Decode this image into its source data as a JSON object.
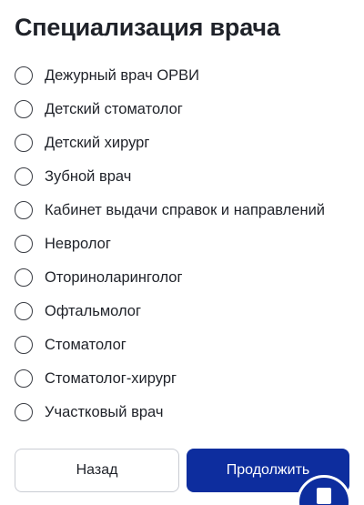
{
  "header": {
    "title": "Специализация врача"
  },
  "specializations": [
    {
      "label": "Дежурный врач ОРВИ",
      "selected": false
    },
    {
      "label": "Детский стоматолог",
      "selected": false
    },
    {
      "label": "Детский хирург",
      "selected": false
    },
    {
      "label": "Зубной врач",
      "selected": false
    },
    {
      "label": "Кабинет выдачи справок и направлений",
      "selected": false
    },
    {
      "label": "Невролог",
      "selected": false
    },
    {
      "label": "Оториноларинголог",
      "selected": false
    },
    {
      "label": "Офтальмолог",
      "selected": false
    },
    {
      "label": "Стоматолог",
      "selected": false
    },
    {
      "label": "Стоматолог-хирург",
      "selected": false
    },
    {
      "label": "Участковый врач",
      "selected": false
    }
  ],
  "footer": {
    "back_label": "Назад",
    "next_label": "Продолжить"
  },
  "chat": {
    "icon": "chat-icon"
  },
  "colors": {
    "primary": "#0d2d9e",
    "text": "#1f2229",
    "border": "#c9ccd3"
  }
}
